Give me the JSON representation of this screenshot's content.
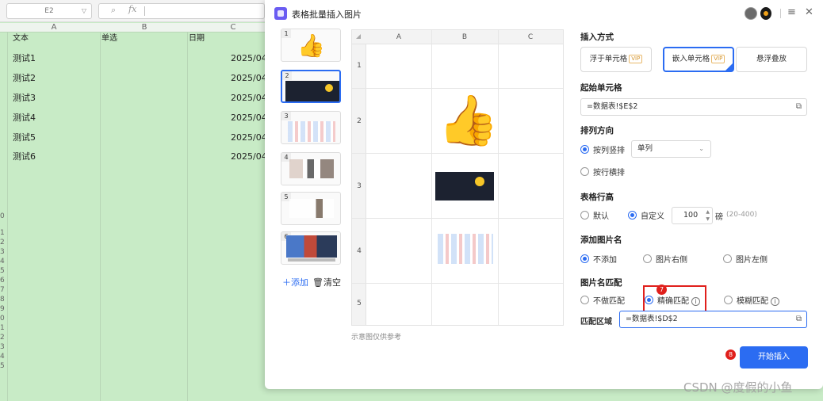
{
  "spreadsheet": {
    "name_box": "E2",
    "columns": [
      "A",
      "B",
      "C"
    ],
    "header_row": [
      "文本",
      "单选",
      "日期"
    ],
    "rows": [
      {
        "text": "测试1",
        "date": "2025/04."
      },
      {
        "text": "测试2",
        "date": "2025/04."
      },
      {
        "text": "测试3",
        "date": "2025/04."
      },
      {
        "text": "测试4",
        "date": "2025/04."
      },
      {
        "text": "测试5",
        "date": "2025/04."
      },
      {
        "text": "测试6",
        "date": "2025/04."
      }
    ],
    "row_numbers": [
      "0",
      "1",
      "2",
      "3",
      "4",
      "5",
      "6",
      "7",
      "8",
      "9",
      "0",
      "1",
      "2",
      "3",
      "4",
      "5"
    ]
  },
  "dialog": {
    "title": "表格批量插入图片",
    "thumbnails": [
      {
        "num": "1",
        "kind": "thumbs-up-image"
      },
      {
        "num": "2",
        "kind": "dark-screenshot"
      },
      {
        "num": "3",
        "kind": "slide-image"
      },
      {
        "num": "4",
        "kind": "people-grid-image"
      },
      {
        "num": "5",
        "kind": "portraits-image"
      },
      {
        "num": "6",
        "kind": "group-photo"
      }
    ],
    "add_label": "添加",
    "clear_label": "清空",
    "preview": {
      "columns": [
        "A",
        "B",
        "C"
      ],
      "rows": [
        "1",
        "2",
        "3",
        "4",
        "5"
      ],
      "note": "示意图仅供参考"
    },
    "insert_mode": {
      "title": "插入方式",
      "options": [
        {
          "label": "浮于单元格",
          "vip": "VIP",
          "active": false
        },
        {
          "label": "嵌入单元格",
          "vip": "VIP",
          "active": true
        },
        {
          "label": "悬浮叠放",
          "vip": "",
          "active": false
        }
      ]
    },
    "start_cell": {
      "title": "起始单元格",
      "value": "=数据表!$E$2"
    },
    "arrange": {
      "title": "排列方向",
      "by_column": "按列竖排",
      "by_column_select": "单列",
      "by_row": "按行横排"
    },
    "row_height": {
      "title": "表格行高",
      "default_label": "默认",
      "custom_label": "自定义",
      "custom_value": "100",
      "unit": "磅",
      "range": "(20-400)"
    },
    "add_name": {
      "title": "添加图片名",
      "options": [
        "不添加",
        "图片右侧",
        "图片左侧"
      ],
      "selected": "不添加"
    },
    "match": {
      "title": "图片名匹配",
      "options": [
        "不做匹配",
        "精确匹配",
        "模糊匹配"
      ],
      "selected": "精确匹配",
      "area_label": "匹配区域",
      "area_value": "=数据表!$D$2"
    },
    "step_badges": [
      "7",
      "8"
    ],
    "start_button": "开始插入"
  },
  "watermark": "CSDN @度假的小鱼",
  "colors": {
    "accent": "#2b6cf2",
    "highlight": "#e0201c",
    "sheet_fill": "#c8ebc6"
  }
}
